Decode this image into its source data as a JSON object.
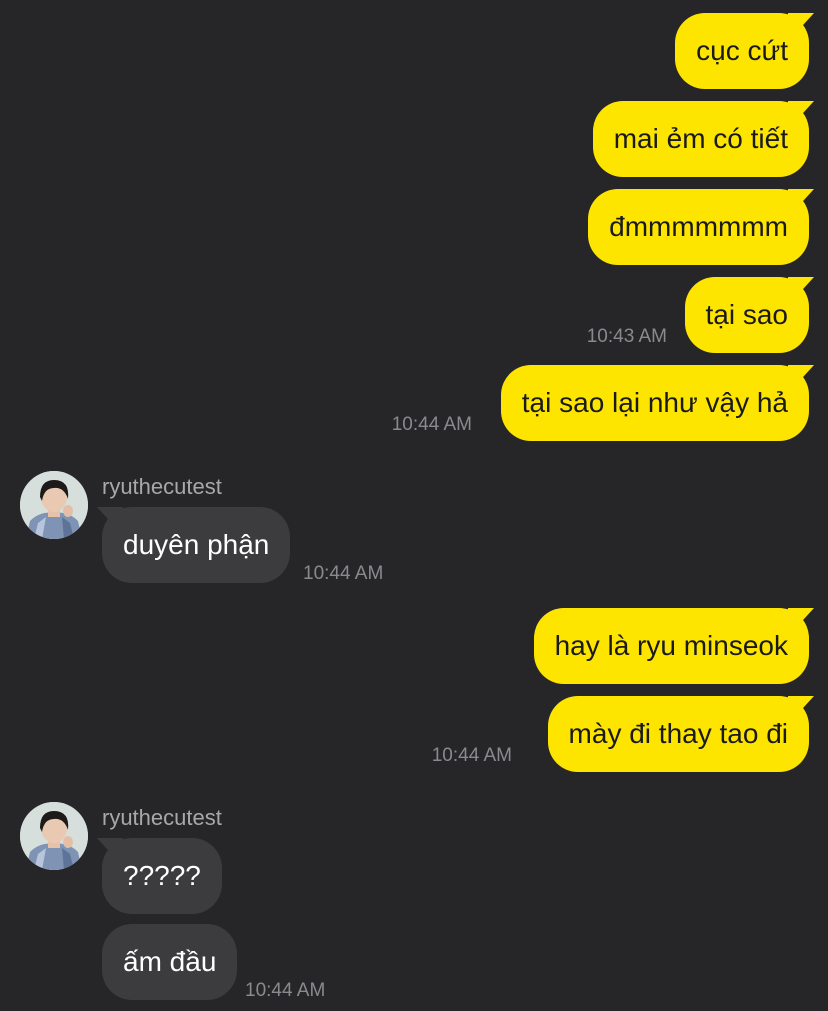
{
  "colors": {
    "background": "#262628",
    "outgoing_bubble": "#FEE500",
    "incoming_bubble": "#3c3c3e",
    "timestamp": "#8a8a8e"
  },
  "messages": [
    {
      "direction": "outgoing",
      "text": "cục cứt"
    },
    {
      "direction": "outgoing",
      "text": "mai ẻm có tiết"
    },
    {
      "direction": "outgoing",
      "text": "đmmmmmmm"
    },
    {
      "direction": "outgoing",
      "text": "tại sao",
      "time": "10:43 AM"
    },
    {
      "direction": "outgoing",
      "text": "tại sao lại như vậy hả",
      "time": "10:44 AM"
    },
    {
      "direction": "incoming",
      "sender": "ryuthecutest",
      "text": "duyên phận",
      "time": "10:44 AM"
    },
    {
      "direction": "outgoing",
      "text": "hay là ryu minseok"
    },
    {
      "direction": "outgoing",
      "text": "mày đi thay tao đi",
      "time": "10:44 AM"
    },
    {
      "direction": "incoming",
      "sender": "ryuthecutest",
      "text": "?????"
    },
    {
      "direction": "incoming",
      "text": "ấm đầu",
      "time": "10:44 AM"
    }
  ]
}
